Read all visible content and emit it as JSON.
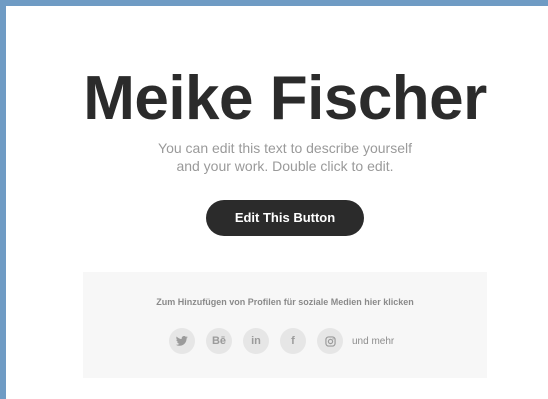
{
  "profile": {
    "name": "Meike Fischer",
    "description_line1": "You can edit this text to describe yourself",
    "description_line2": "and your work. Double click to edit."
  },
  "cta": {
    "label": "Edit This Button"
  },
  "social": {
    "hint": "Zum Hinzufügen von Profilen für soziale Medien hier klicken",
    "icons": [
      {
        "name": "twitter-icon",
        "glyph": ""
      },
      {
        "name": "behance-icon",
        "glyph": "Bē"
      },
      {
        "name": "linkedin-icon",
        "glyph": "in"
      },
      {
        "name": "facebook-icon",
        "glyph": "f"
      },
      {
        "name": "instagram-icon",
        "glyph": ""
      }
    ],
    "more_label": "und mehr"
  },
  "colors": {
    "frame_edge": "#6f9bc4",
    "text_dark": "#2b2b2b",
    "text_muted": "#9a9a9a",
    "panel_bg": "#f7f7f7",
    "icon_bg": "#e6e6e6"
  }
}
